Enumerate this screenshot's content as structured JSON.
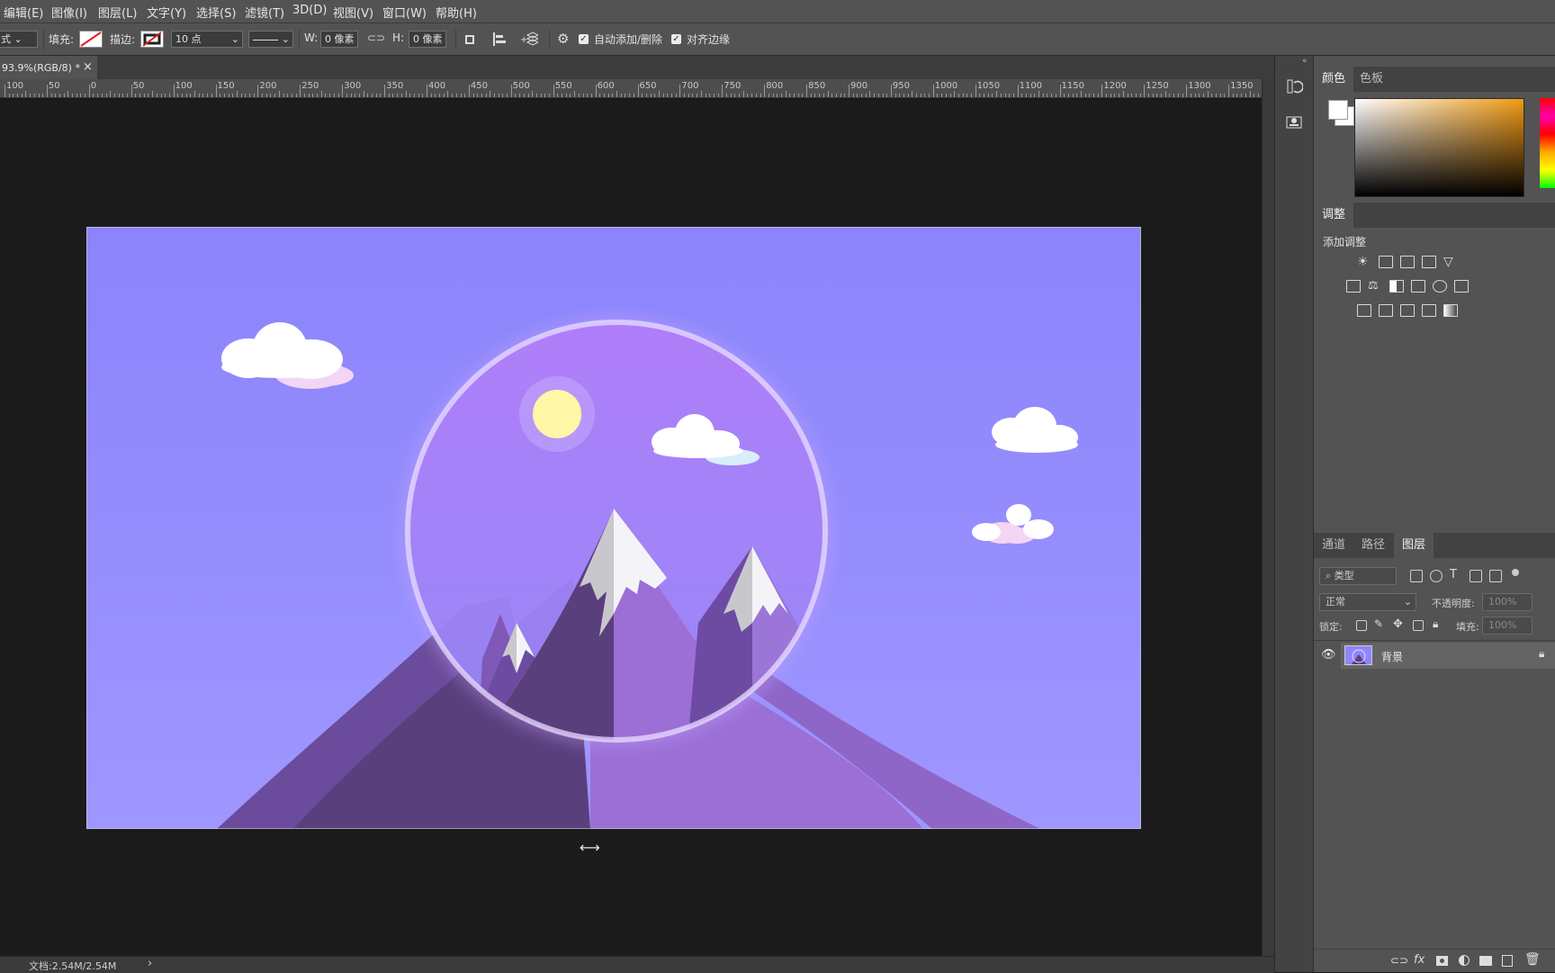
{
  "menu": [
    "编辑(E)",
    "图像(I)",
    "图层(L)",
    "文字(Y)",
    "选择(S)",
    "滤镜(T)",
    "3D(D)",
    "视图(V)",
    "窗口(W)",
    "帮助(H)"
  ],
  "options": {
    "fill_label": "填充:",
    "stroke_label": "描边:",
    "stroke_width": "10 点",
    "w_label": "W:",
    "w_value": "0 像素",
    "h_label": "H:",
    "h_value": "0 像素",
    "auto_add_delete": "自动添加/删除",
    "align_edges": "对齐边缘"
  },
  "document": {
    "tab_label": "93.9%(RGB/8) *",
    "close_glyph": "×"
  },
  "ruler_labels": [
    "100",
    "50",
    "0",
    "50",
    "100",
    "150",
    "200",
    "250",
    "300",
    "350",
    "400",
    "450",
    "500",
    "550",
    "600",
    "650",
    "700",
    "750",
    "800",
    "850",
    "900",
    "950",
    "1000",
    "1050",
    "1100",
    "1150",
    "1200",
    "1250",
    "1300",
    "1350"
  ],
  "status": {
    "doc_info": "文档:2.54M/2.54M",
    "arrow": "›"
  },
  "color_panel": {
    "tabs": [
      "颜色",
      "色板"
    ],
    "foreground": "#ffffff",
    "background": "#ffffff",
    "hue_color": "#f29a14"
  },
  "adjust_panel": {
    "tab": "调整",
    "heading": "添加调整"
  },
  "layers_panel": {
    "tabs": [
      "通道",
      "路径",
      "图层"
    ],
    "filter_kind": "类型",
    "blend_mode": "正常",
    "opacity_label": "不透明度:",
    "opacity_value": "100%",
    "lock_label": "锁定:",
    "fill_label": "填充:",
    "fill_value": "100%",
    "layers": [
      {
        "name": "背景",
        "visible": true,
        "locked": true
      }
    ],
    "footer_icons": [
      "link-icon",
      "fx-icon",
      "mask-icon",
      "adjustment-icon",
      "folder-icon",
      "new-layer-icon",
      "trash-icon"
    ]
  },
  "colors": {
    "sky": "#8e86fb",
    "mountain_dark": "#5a3f7d",
    "mountain_light": "#9b6fd6",
    "sun": "#fff6a6"
  }
}
